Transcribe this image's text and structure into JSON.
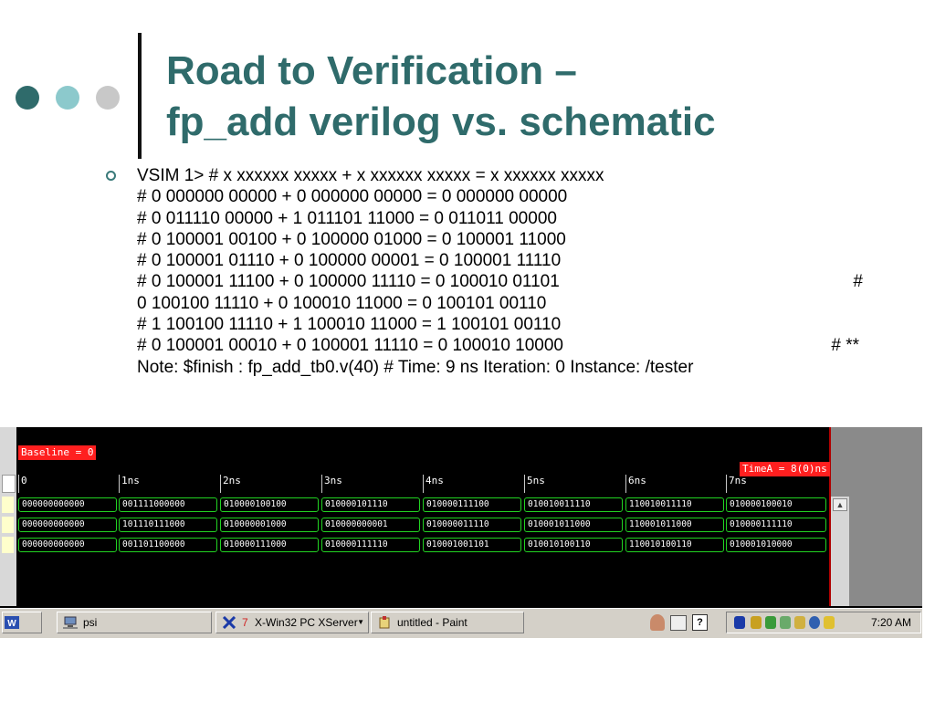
{
  "slide": {
    "title_line1": "Road to Verification –",
    "title_line2": "fp_add verilog vs. schematic",
    "lines": [
      [
        "VSIM 1> # x xxxxxx xxxxx + x xxxxxx xxxxx = x xxxxxx xxxxx"
      ],
      [
        "# 0 000000 00000 + 0 000000 00000 = 0 000000 00000"
      ],
      [
        "# 0 011110 00000 + 1 011101 11000 = 0 011011 00000"
      ],
      [
        "# 0 100001 00100 + 0 100000 01000 = 0 100001 11000"
      ],
      [
        "# 0 100001 01110 + 0 100000 00001 = 0 100001 11110"
      ],
      [
        "# 0 100001 11100 + 0 100000 11110 = 0 100010 01101",
        "#"
      ],
      [
        "0 100100 11110 + 0 100010 11000 = 0 100101 00110"
      ],
      [
        "# 1 100100 11110 + 1 100010 11000 = 1 100101 00110"
      ],
      [
        "# 0 100001 00010 + 0 100001 11110 = 0 100010 10000",
        "# **"
      ],
      [
        "Note: $finish : fp_add_tb0.v(40) # Time: 9 ns Iteration: 0 Instance: /tester"
      ]
    ],
    "colors": {
      "title": "#2f6b6b",
      "dots": [
        "#2f6b6b",
        "#8cc9cc",
        "#c8c8c8"
      ]
    }
  },
  "waveform": {
    "baseline_label": "Baseline = 0",
    "timea_label": "TimeA = 8(0)ns",
    "ticks": [
      "0",
      "1ns",
      "2ns",
      "3ns",
      "4ns",
      "5ns",
      "6ns",
      "7ns"
    ],
    "rows": [
      [
        "000000000000",
        "001111000000",
        "010000100100",
        "010000101110",
        "010000111100",
        "010010011110",
        "110010011110",
        "010000100010"
      ],
      [
        "000000000000",
        "101110111000",
        "010000001000",
        "010000000001",
        "010000011110",
        "010001011000",
        "110001011000",
        "010000111110"
      ],
      [
        "000000000000",
        "001101100000",
        "010000111000",
        "010000111110",
        "010001001101",
        "010010100110",
        "110010100110",
        "010001010000"
      ]
    ],
    "signal_color": "#22d322",
    "marker_color": "#ff1f1f"
  },
  "taskbar": {
    "buttons": [
      {
        "label": "psi",
        "icon": "network-computer-icon"
      },
      {
        "label": "X-Win32 PC XServer",
        "count": "7",
        "icon": "xwin-x-icon"
      },
      {
        "label": "untitled - Paint",
        "icon": "paint-icon"
      }
    ],
    "clock": "7:20 AM"
  }
}
